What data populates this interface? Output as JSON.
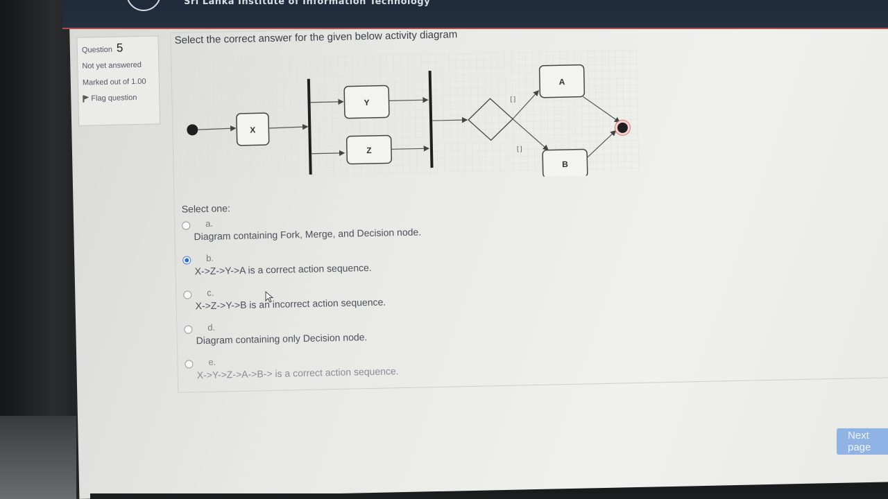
{
  "header": {
    "site_title": "Sri Lanka Institute of Information Technology"
  },
  "question_info": {
    "label": "Question",
    "number": "5",
    "status": "Not yet answered",
    "marked_out_of": "Marked out of 1.00",
    "flag_label": "Flag question"
  },
  "question": {
    "text": "Select the correct answer for the given below activity diagram",
    "diagram": {
      "nodes": [
        "X",
        "Y",
        "Z",
        "A",
        "B"
      ],
      "guards": [
        "[ ]",
        "[ ]"
      ]
    }
  },
  "answers": {
    "prompt": "Select one:",
    "options": [
      {
        "letter": "a.",
        "text": "Diagram containing Fork, Merge, and Decision node.",
        "selected": false
      },
      {
        "letter": "b.",
        "text": "X->Z->Y->A is a correct action sequence.",
        "selected": true
      },
      {
        "letter": "c.",
        "text": "X->Z->Y->B is an incorrect action sequence.",
        "selected": false
      },
      {
        "letter": "d.",
        "text": "Diagram containing only Decision node.",
        "selected": false
      },
      {
        "letter": "e.",
        "text": "X->Y->Z->A->B-> is a correct action sequence.",
        "selected": false
      }
    ]
  },
  "navigation": {
    "next_label": "Next page"
  },
  "colors": {
    "selected_radio": "#2f68d0",
    "next_button": "#8fb3e4",
    "header_accent": "#b54a4a"
  }
}
